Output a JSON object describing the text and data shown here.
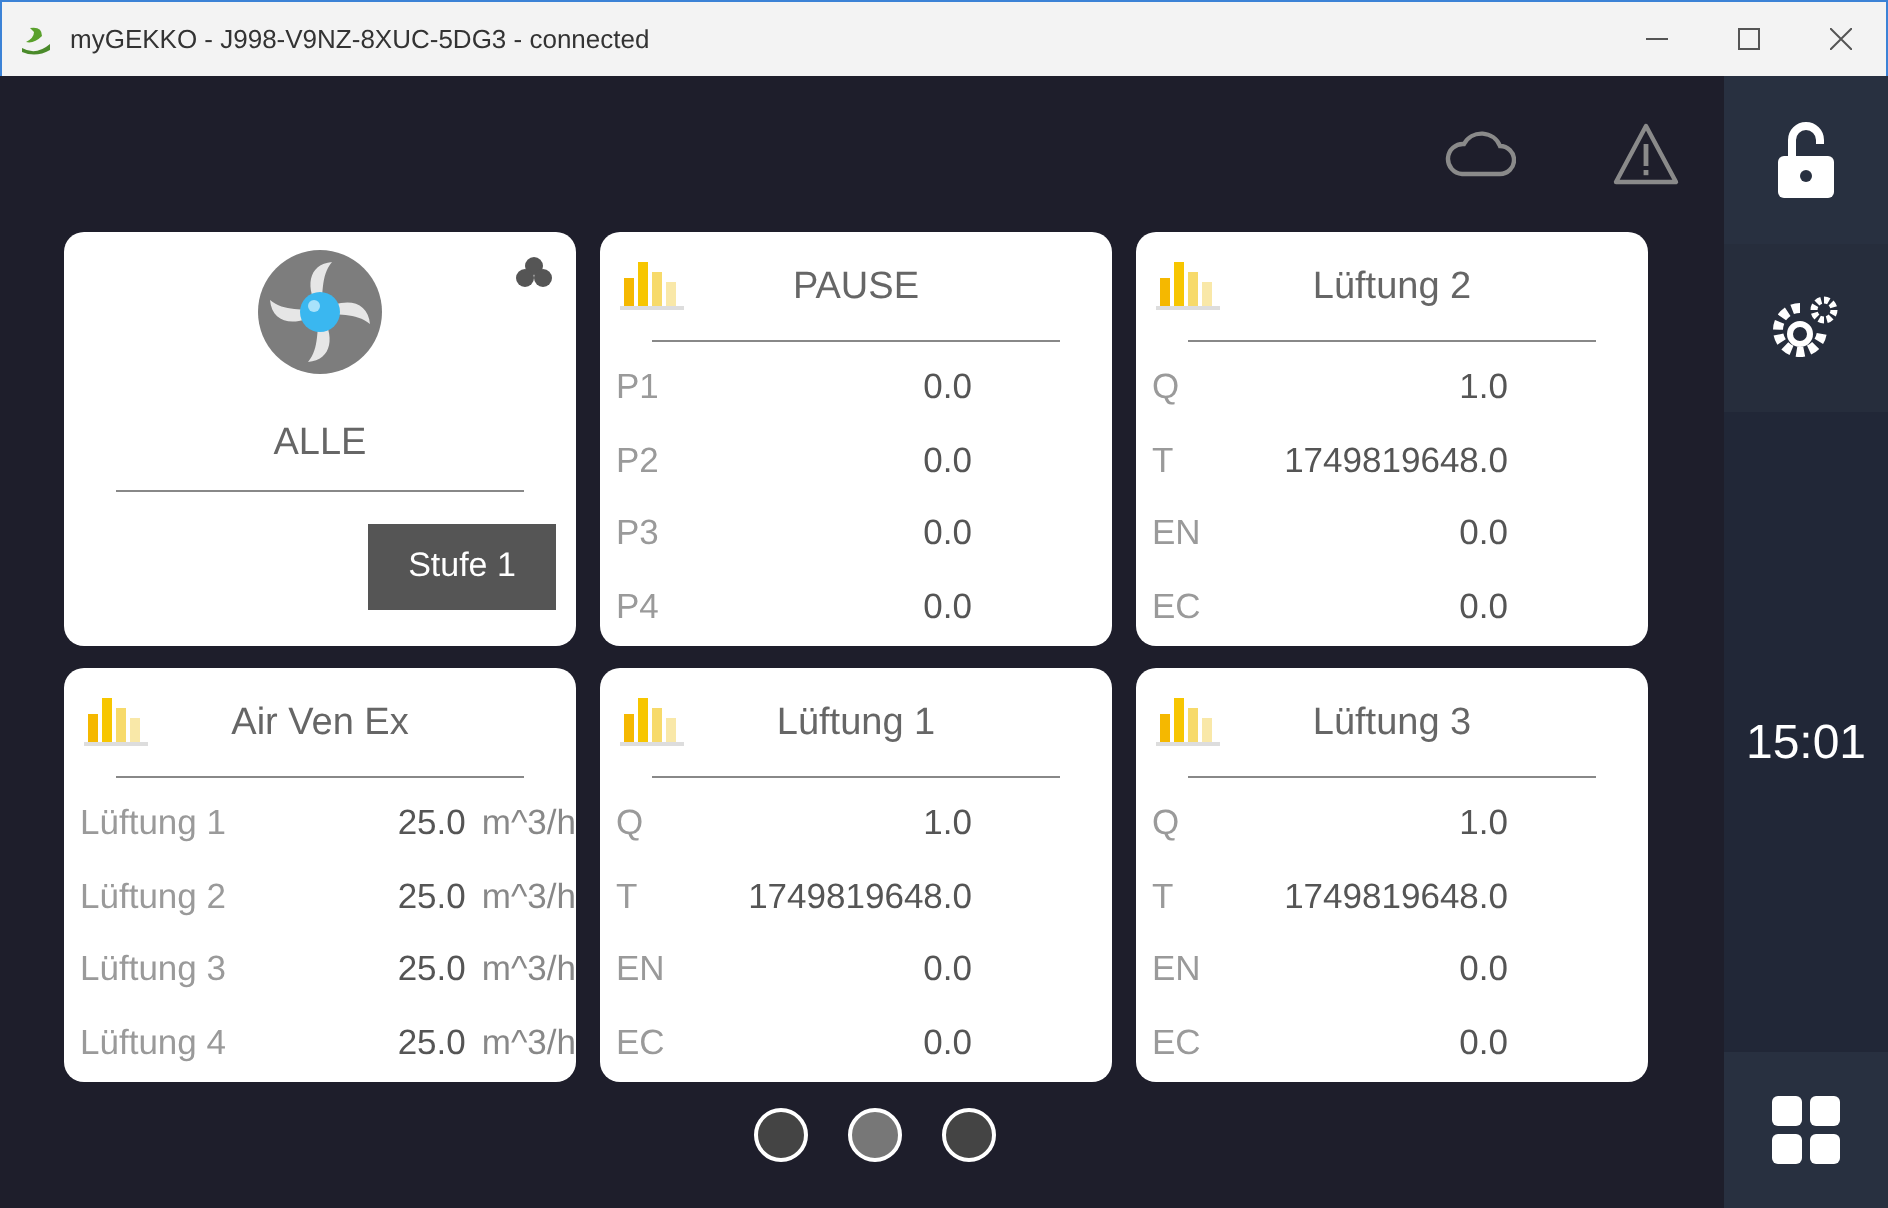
{
  "window": {
    "title": "myGEKKO - J998-V9NZ-8XUC-5DG3 - connected"
  },
  "tiles": [
    {
      "kind": "fan",
      "title": "ALLE",
      "button": "Stufe 1"
    },
    {
      "kind": "table",
      "title": "PAUSE",
      "rows": [
        {
          "label": "P1",
          "value": "0.0"
        },
        {
          "label": "P2",
          "value": "0.0"
        },
        {
          "label": "P3",
          "value": "0.0"
        },
        {
          "label": "P4",
          "value": "0.0"
        }
      ]
    },
    {
      "kind": "table",
      "title": "Lüftung 2",
      "rows": [
        {
          "label": "Q",
          "value": "1.0"
        },
        {
          "label": "T",
          "value": "1749819648.0"
        },
        {
          "label": "EN",
          "value": "0.0"
        },
        {
          "label": "EC",
          "value": "0.0"
        }
      ]
    },
    {
      "kind": "units",
      "title": "Air Ven Ex",
      "rows": [
        {
          "label": "Lüftung 1",
          "value": "25.0",
          "unit": "m^3/h"
        },
        {
          "label": "Lüftung 2",
          "value": "25.0",
          "unit": "m^3/h"
        },
        {
          "label": "Lüftung 3",
          "value": "25.0",
          "unit": "m^3/h"
        },
        {
          "label": "Lüftung 4",
          "value": "25.0",
          "unit": "m^3/h"
        }
      ]
    },
    {
      "kind": "table",
      "title": "Lüftung 1",
      "rows": [
        {
          "label": "Q",
          "value": "1.0"
        },
        {
          "label": "T",
          "value": "1749819648.0"
        },
        {
          "label": "EN",
          "value": "0.0"
        },
        {
          "label": "EC",
          "value": "0.0"
        }
      ]
    },
    {
      "kind": "table",
      "title": "Lüftung 3",
      "rows": [
        {
          "label": "Q",
          "value": "1.0"
        },
        {
          "label": "T",
          "value": "1749819648.0"
        },
        {
          "label": "EN",
          "value": "0.0"
        },
        {
          "label": "EC",
          "value": "0.0"
        }
      ]
    }
  ],
  "pager": [
    {
      "selected": false
    },
    {
      "selected": true
    },
    {
      "selected": false
    }
  ],
  "sidebar": {
    "time": "15:01"
  }
}
